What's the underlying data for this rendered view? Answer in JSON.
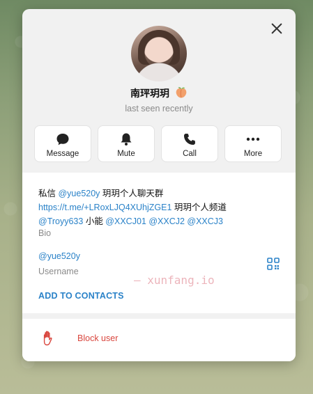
{
  "profile": {
    "name": "南玶玥玥",
    "status": "last seen recently"
  },
  "actions": [
    {
      "label": "Message",
      "icon": "chat-bubble-icon"
    },
    {
      "label": "Mute",
      "icon": "bell-icon"
    },
    {
      "label": "Call",
      "icon": "phone-icon"
    },
    {
      "label": "More",
      "icon": "more-dots-icon"
    }
  ],
  "bio": {
    "line1_prefix": "私信 ",
    "line1_mention": "@yue520y",
    "line1_suffix": " 玥玥个人聊天群",
    "line2_link": "https://t.me/+LRoxLJQ4XUhjZGE1",
    "line2_suffix": " 玥玥个人频道",
    "line3_mention1": "@Troyy633",
    "line3_text": " 小能 ",
    "line3_mention2": "@XXCJ01",
    "line3_mention3": "@XXCJ2",
    "line3_mention4": "@XXCJ3",
    "label": "Bio"
  },
  "username": {
    "value": "@yue520y",
    "label": "Username"
  },
  "add_contacts_label": "ADD TO CONTACTS",
  "block_label": "Block user",
  "watermark": "— xunfang.io",
  "colors": {
    "accent": "#2a82c8",
    "danger": "#d9463e"
  }
}
